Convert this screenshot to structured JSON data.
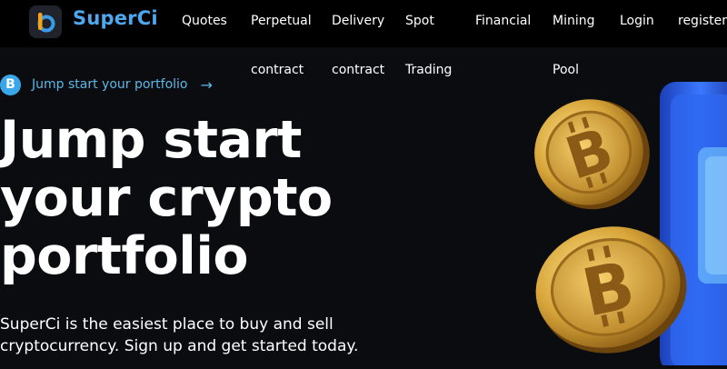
{
  "header": {
    "brand": "SuperCi",
    "nav": [
      {
        "line1": "Quotes",
        "line2": ""
      },
      {
        "line1": "Perpetual",
        "line2": "contract"
      },
      {
        "line1": "Delivery",
        "line2": "contract"
      },
      {
        "line1": "Spot",
        "line2": "Trading"
      },
      {
        "line1": "Financial",
        "line2": ""
      },
      {
        "line1": "Mining",
        "line2": "Pool"
      },
      {
        "line1": "Login",
        "line2": ""
      },
      {
        "line1": "register",
        "line2": ""
      }
    ]
  },
  "promo": {
    "icon_glyph": "B",
    "text": "Jump start your portfolio",
    "arrow": "→"
  },
  "hero": {
    "headline": [
      "Jump start",
      "your crypto",
      "portfolio"
    ],
    "subtext": [
      "SuperCi is the easiest place to buy and sell",
      "cryptocurrency. Sign up and get started today."
    ]
  },
  "colors": {
    "background": "#0b0c10",
    "topbar": "#000000",
    "brand": "#4ea8f0",
    "promo_accent": "#5bb9e8",
    "coin_gold": "#d8a63a",
    "device_blue": "#2f6bf0"
  },
  "icons": {
    "logo": "superci-logo-icon",
    "promo": "bitcoin-icon",
    "arrow": "arrow-right-icon",
    "coins": "bitcoin-coin-icon"
  }
}
